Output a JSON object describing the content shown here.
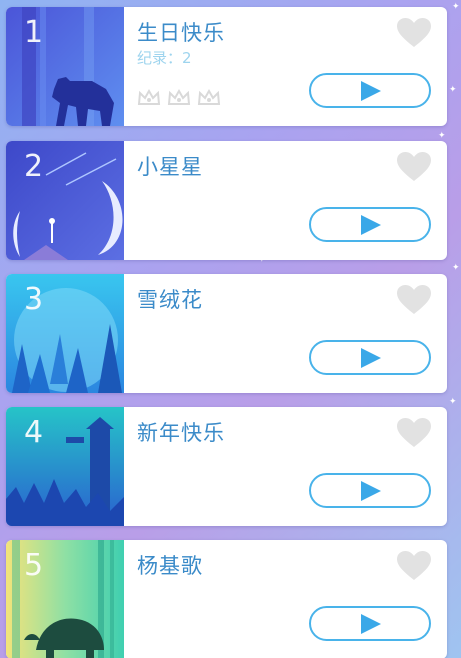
{
  "songs": [
    {
      "number": "1",
      "title": "生日快乐",
      "record": "纪录：2",
      "crowns": 3,
      "favorited": false,
      "play_icon": "play-icon",
      "favorite_icon": "heart-icon"
    },
    {
      "number": "2",
      "title": "小星星",
      "record": "",
      "crowns": 0,
      "favorited": false,
      "play_icon": "play-icon",
      "favorite_icon": "heart-icon"
    },
    {
      "number": "3",
      "title": "雪绒花",
      "record": "",
      "crowns": 0,
      "favorited": false,
      "play_icon": "play-icon",
      "favorite_icon": "heart-icon"
    },
    {
      "number": "4",
      "title": "新年快乐",
      "record": "",
      "crowns": 0,
      "favorited": false,
      "play_icon": "play-icon",
      "favorite_icon": "heart-icon"
    },
    {
      "number": "5",
      "title": "杨基歌",
      "record": "",
      "crowns": 0,
      "favorited": false,
      "play_icon": "play-icon",
      "favorite_icon": "heart-icon"
    }
  ],
  "colors": {
    "title": "#3b8bc9",
    "record": "#9ed4ee",
    "play_accent": "#49b3ea",
    "heart": "#e2e2e2",
    "crown": "#d9d9d9"
  }
}
